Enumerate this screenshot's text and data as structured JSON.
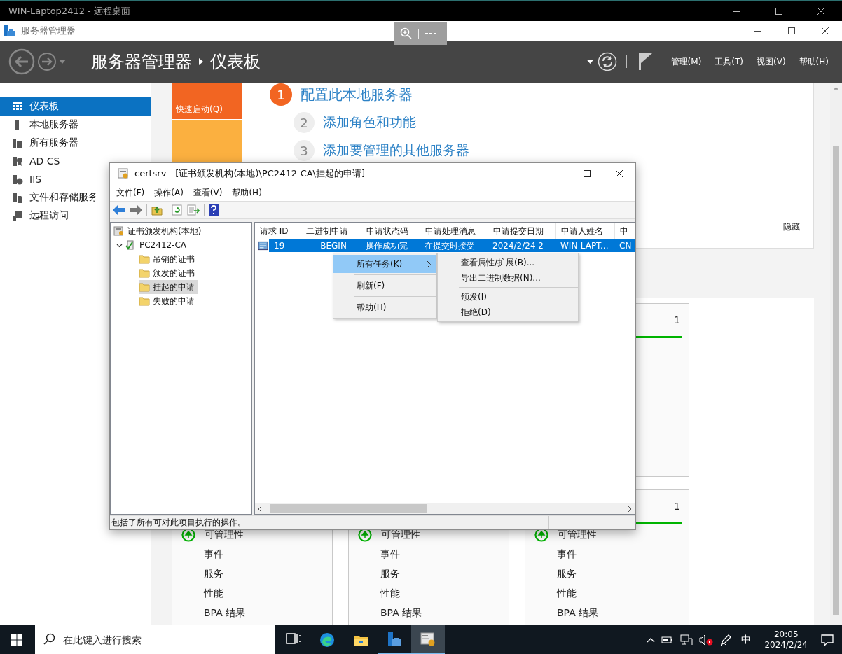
{
  "rdp_window": {
    "title": "WIN-Laptop2412 - 远程桌面"
  },
  "app_window": {
    "title": "服务器管理器"
  },
  "header": {
    "breadcrumb": [
      "服务器管理器",
      "仪表板"
    ],
    "menus": [
      "管理(M)",
      "工具(T)",
      "视图(V)",
      "帮助(H)"
    ]
  },
  "sidebar": {
    "items": [
      {
        "kind": "dashboard",
        "label": "仪表板",
        "selected": true
      },
      {
        "kind": "local",
        "label": "本地服务器",
        "selected": false
      },
      {
        "kind": "all",
        "label": "所有服务器",
        "selected": false
      },
      {
        "kind": "adcs",
        "label": "AD CS",
        "selected": false
      },
      {
        "kind": "iis",
        "label": "IIS",
        "selected": false
      },
      {
        "kind": "files",
        "label": "文件和存储服务",
        "selected": false
      },
      {
        "kind": "remote",
        "label": "远程访问",
        "selected": false
      }
    ]
  },
  "welcome": {
    "quick_start": "快速启动(Q)",
    "steps": [
      {
        "number": "1",
        "label": "配置此本地服务器",
        "active": true
      },
      {
        "number": "2",
        "label": "添加角色和功能",
        "active": false
      },
      {
        "number": "3",
        "label": "添加要管理的其他服务器",
        "active": false
      }
    ],
    "hide": "隐藏"
  },
  "card_rows": [
    [
      {
        "count": "1"
      }
    ],
    [
      {
        "items": [
          {
            "kind": "status",
            "label": "可管理性"
          },
          {
            "kind": "link",
            "label": "事件"
          },
          {
            "kind": "link",
            "label": "服务"
          },
          {
            "kind": "link",
            "label": "性能"
          },
          {
            "kind": "link",
            "label": "BPA 结果"
          }
        ]
      },
      {
        "items": [
          {
            "kind": "status",
            "label": "可管理性"
          },
          {
            "kind": "link",
            "label": "事件"
          },
          {
            "kind": "link",
            "label": "服务"
          },
          {
            "kind": "link",
            "label": "性能"
          },
          {
            "kind": "link",
            "label": "BPA 结果"
          }
        ]
      },
      {
        "count": "1",
        "items": [
          {
            "kind": "status",
            "label": "可管理性"
          },
          {
            "kind": "link",
            "label": "事件"
          },
          {
            "kind": "link",
            "label": "服务"
          },
          {
            "kind": "link",
            "label": "性能"
          },
          {
            "kind": "link",
            "label": "BPA 结果"
          }
        ]
      }
    ]
  ],
  "certsrv": {
    "title": "certsrv - [证书颁发机构(本地)\\PC2412-CA\\挂起的申请]",
    "menus": [
      "文件(F)",
      "操作(A)",
      "查看(V)",
      "帮助(H)"
    ],
    "tree": [
      {
        "kind": "root",
        "label": "证书颁发机构(本地)",
        "selected": false,
        "children": [
          {
            "kind": "ca",
            "label": "PC2412-CA",
            "selected": false,
            "expanded": true,
            "children": [
              {
                "kind": "folder",
                "label": "吊销的证书",
                "selected": false
              },
              {
                "kind": "folder",
                "label": "颁发的证书",
                "selected": false
              },
              {
                "kind": "folder",
                "label": "挂起的申请",
                "selected": true
              },
              {
                "kind": "folder",
                "label": "失败的申请",
                "selected": false
              }
            ]
          }
        ]
      }
    ],
    "table": {
      "columns": [
        "请求 ID",
        "二进制申请",
        "申请状态码",
        "申请处理消息",
        "申请提交日期",
        "申请人姓名",
        "申"
      ],
      "rows": [
        {
          "selected": true,
          "cells": [
            "19",
            "-----BEGIN",
            "操作成功完",
            "在提交时接受",
            "2024/2/24 2",
            "WIN-LAPT...",
            "CN"
          ]
        }
      ]
    },
    "status_bar": "包括了所有可对此项目执行的操作。"
  },
  "context_menu": {
    "items": [
      {
        "kind": "item",
        "label": "所有任务(K)",
        "submenu": true,
        "selected": true
      },
      {
        "kind": "separator"
      },
      {
        "kind": "item",
        "label": "刷新(F)",
        "submenu": false,
        "selected": false
      },
      {
        "kind": "separator"
      },
      {
        "kind": "item",
        "label": "帮助(H)",
        "submenu": false,
        "selected": false
      }
    ]
  },
  "submenu": {
    "items": [
      {
        "kind": "item",
        "label": "查看属性/扩展(B)...",
        "selected": false
      },
      {
        "kind": "item",
        "label": "导出二进制数据(N)...",
        "selected": false
      },
      {
        "kind": "separator"
      },
      {
        "kind": "item",
        "label": "颁发(I)",
        "selected": false
      },
      {
        "kind": "item",
        "label": "拒绝(D)",
        "selected": false
      }
    ]
  },
  "taskbar": {
    "search": {
      "placeholder": "在此键入进行搜索"
    },
    "apps": [
      {
        "kind": "taskview",
        "running": false,
        "selected": false
      },
      {
        "kind": "edge",
        "running": false,
        "selected": false
      },
      {
        "kind": "explorer",
        "running": false,
        "selected": false
      },
      {
        "kind": "servermanager",
        "running": true,
        "selected": false
      },
      {
        "kind": "certsrv",
        "running": true,
        "selected": true
      }
    ],
    "ime": "中",
    "time": "20:05",
    "date": "2024/2/24"
  }
}
